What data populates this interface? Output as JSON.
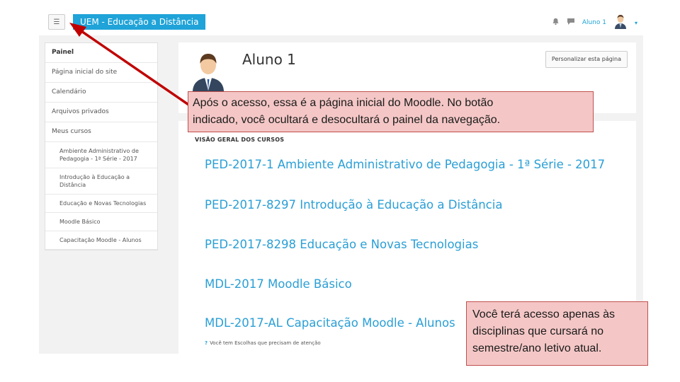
{
  "navbar": {
    "toggle_icon": "hamburger-icon",
    "brand": "UEM - Educação a Distância",
    "bell_icon": "bell-icon",
    "message_icon": "message-icon",
    "user_name": "Aluno 1",
    "caret": "▾"
  },
  "drawer": {
    "items": [
      {
        "label": "Painel"
      },
      {
        "label": "Página inicial do site"
      },
      {
        "label": "Calendário"
      },
      {
        "label": "Arquivos privados"
      },
      {
        "label": "Meus cursos"
      }
    ],
    "courses": [
      {
        "label": "Ambiente Administrativo de Pedagogia - 1ª Série - 2017"
      },
      {
        "label": "Introdução à Educação a Distância"
      },
      {
        "label": "Educação e Novas Tecnologias"
      },
      {
        "label": "Moodle Básico"
      },
      {
        "label": "Capacitação Moodle - Alunos"
      }
    ]
  },
  "header": {
    "user_title": "Aluno 1",
    "customize_button": "Personalizar esta página"
  },
  "overview": {
    "title": "VISÃO GERAL DOS CURSOS",
    "courses": [
      "PED-2017-1 Ambiente Administrativo de Pedagogia - 1ª Série - 2017",
      "PED-2017-8297 Introdução à Educação a Distância",
      "PED-2017-8298 Educação e Novas Tecnologias",
      "MDL-2017 Moodle Básico",
      "MDL-2017-AL Capacitação Moodle - Alunos"
    ],
    "attention_icon": "?",
    "attention_text": "Você tem Escolhas que precisam de atenção"
  },
  "callouts": {
    "nav_hint_line1": "Após o acesso, essa é a página inicial do Moodle. No botão",
    "nav_hint_line2": "indicado, você ocultará e desocultará o painel da navegação.",
    "access_line1": "Você terá acesso apenas às",
    "access_line2": "disciplinas que cursará no",
    "access_line3": "semestre/ano letivo atual."
  },
  "colors": {
    "brand": "#1fa3d8",
    "link": "#2a9fd6",
    "callout_fill": "#f4c7c6",
    "callout_border": "#c0504d",
    "arrow": "#c00000"
  }
}
